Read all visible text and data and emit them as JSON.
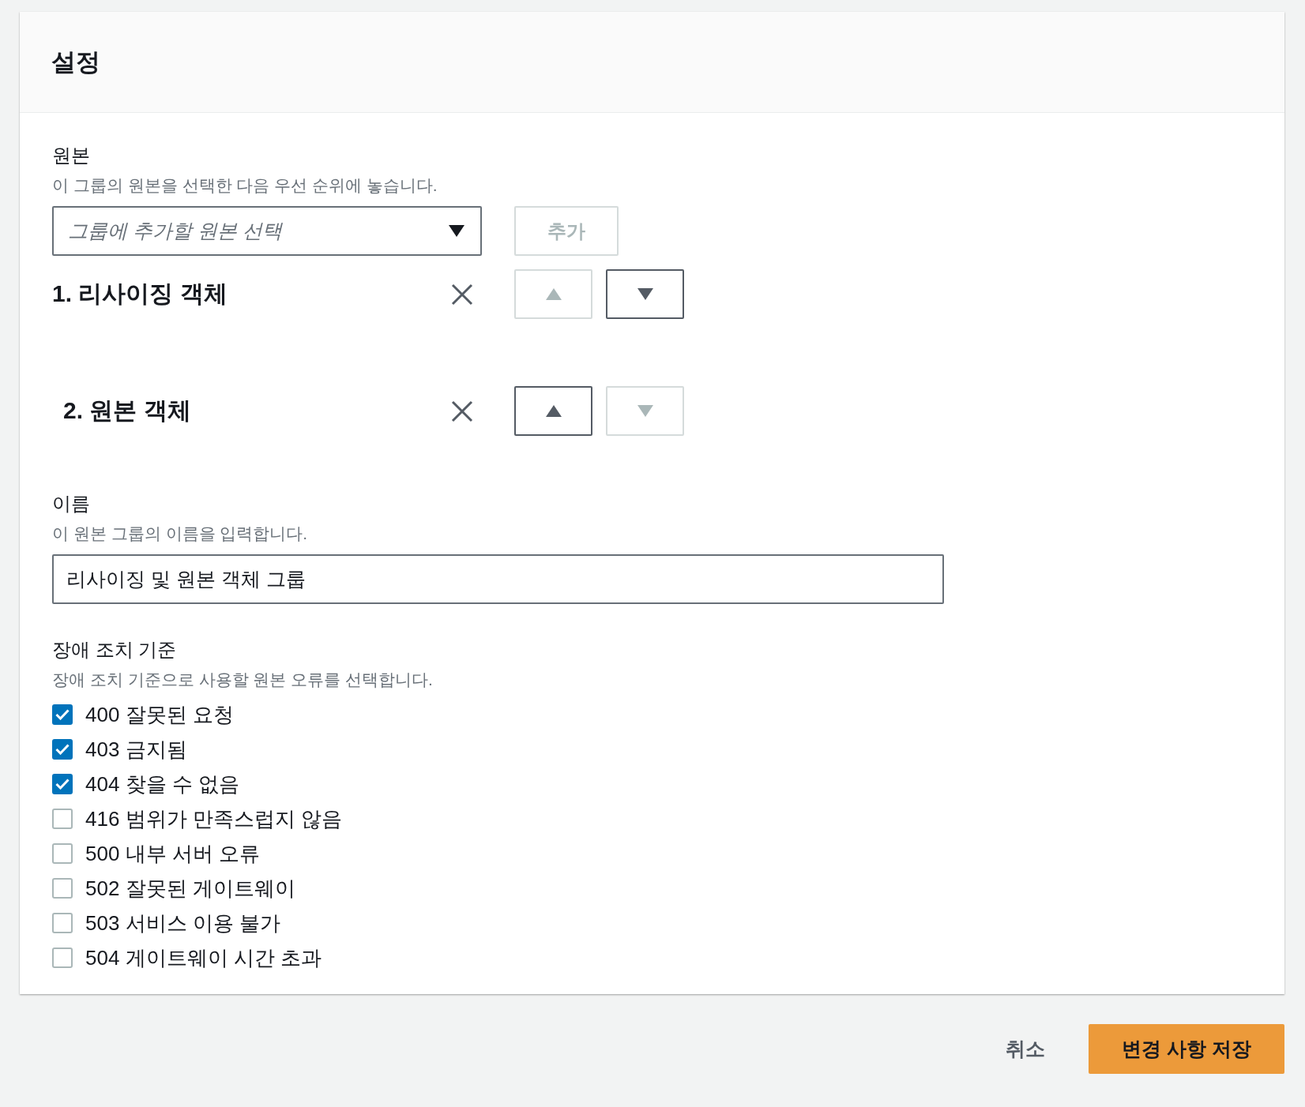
{
  "panel": {
    "title": "설정"
  },
  "origins": {
    "label": "원본",
    "description": "이 그룹의 원본을 선택한 다음 우선 순위에 놓습니다.",
    "select": {
      "placeholder": "그룹에 추가할 원본 선택"
    },
    "add_button": {
      "label": "추가",
      "disabled": true
    },
    "items": [
      {
        "label": "1. 리사이징 객체",
        "up_disabled": true,
        "down_disabled": false
      },
      {
        "label": "2. 원본 객체",
        "up_disabled": false,
        "down_disabled": true
      }
    ]
  },
  "name": {
    "label": "이름",
    "description": "이 원본 그룹의 이름을 입력합니다.",
    "value": "리사이징 및 원본 객체 그룹"
  },
  "failover": {
    "label": "장애 조치 기준",
    "description": "장애 조치 기준으로 사용할 원본 오류를 선택합니다.",
    "options": [
      {
        "label": "400 잘못된 요청",
        "checked": true
      },
      {
        "label": "403 금지됨",
        "checked": true
      },
      {
        "label": "404 찾을 수 없음",
        "checked": true
      },
      {
        "label": "416 범위가 만족스럽지 않음",
        "checked": false
      },
      {
        "label": "500 내부 서버 오류",
        "checked": false
      },
      {
        "label": "502 잘못된 게이트웨이",
        "checked": false
      },
      {
        "label": "503 서비스 이용 불가",
        "checked": false
      },
      {
        "label": "504 게이트웨이 시간 초과",
        "checked": false
      }
    ]
  },
  "buttons": {
    "cancel": "취소",
    "save": "변경 사항 저장"
  }
}
